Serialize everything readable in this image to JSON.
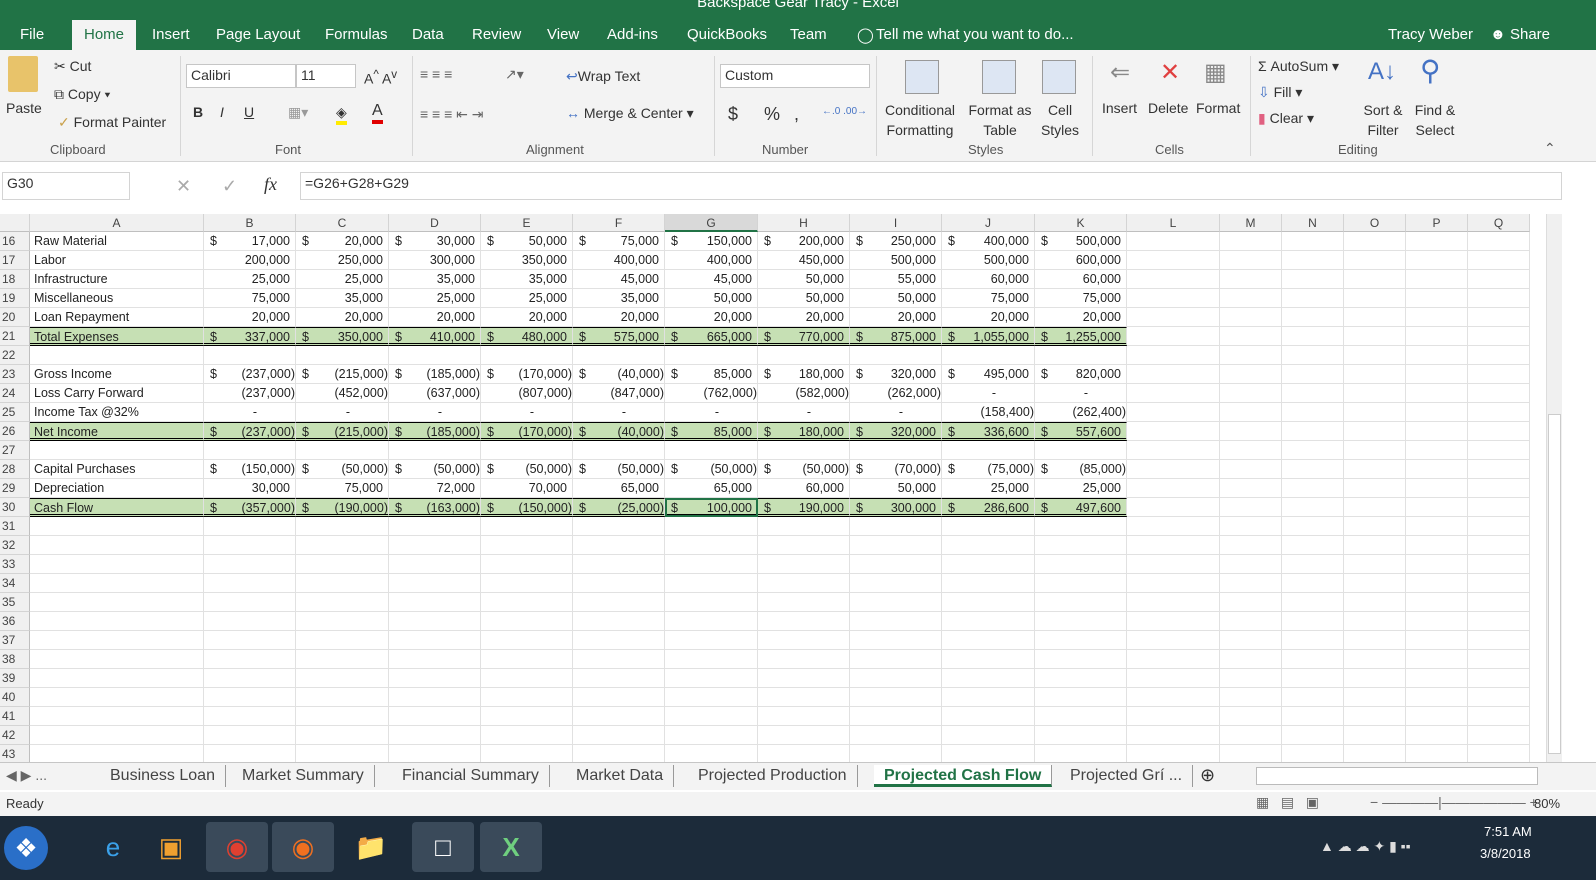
{
  "title": "Backspace Gear Tracy - Excel",
  "ribbon_tabs": [
    "File",
    "Home",
    "Insert",
    "Page Layout",
    "Formulas",
    "Data",
    "Review",
    "View",
    "Add-ins",
    "QuickBooks",
    "Team"
  ],
  "tell_me": "Tell me what you want to do...",
  "user": "Tracy Weber",
  "share": "Share",
  "clipboard": {
    "paste": "Paste",
    "cut": "Cut",
    "copy": "Copy",
    "format_painter": "Format Painter",
    "group": "Clipboard"
  },
  "font": {
    "name": "Calibri",
    "size": "11",
    "group": "Font",
    "bold": "B",
    "italic": "I",
    "underline": "U"
  },
  "alignment": {
    "wrap": "Wrap Text",
    "merge": "Merge & Center",
    "group": "Alignment"
  },
  "number": {
    "format": "Custom",
    "currency": "$",
    "percent": "%",
    "comma": ",",
    "group": "Number"
  },
  "styles": {
    "conditional": "Conditional Formatting",
    "format_table": "Format as Table",
    "cell_styles": "Cell Styles",
    "group": "Styles"
  },
  "cells": {
    "insert": "Insert",
    "delete": "Delete",
    "format": "Format",
    "group": "Cells"
  },
  "editing": {
    "autosum": "AutoSum",
    "fill": "Fill",
    "clear": "Clear",
    "sort": "Sort & Filter",
    "find": "Find & Select",
    "group": "Editing"
  },
  "name_box": "G30",
  "formula": "=G26+G28+G29",
  "columns": [
    "A",
    "B",
    "C",
    "D",
    "E",
    "F",
    "G",
    "H",
    "I",
    "J",
    "K",
    "L",
    "M",
    "N",
    "O",
    "P",
    "Q"
  ],
  "selected_column": "G",
  "rows": [
    {
      "n": "16",
      "label": "Raw Material",
      "dollar": true,
      "values": [
        "17,000",
        "20,000",
        "30,000",
        "50,000",
        "75,000",
        "150,000",
        "200,000",
        "250,000",
        "400,000",
        "500,000"
      ]
    },
    {
      "n": "17",
      "label": "Labor",
      "values": [
        "200,000",
        "250,000",
        "300,000",
        "350,000",
        "400,000",
        "400,000",
        "450,000",
        "500,000",
        "500,000",
        "600,000"
      ]
    },
    {
      "n": "18",
      "label": "Infrastructure",
      "values": [
        "25,000",
        "25,000",
        "35,000",
        "35,000",
        "45,000",
        "45,000",
        "50,000",
        "55,000",
        "60,000",
        "60,000"
      ]
    },
    {
      "n": "19",
      "label": "Miscellaneous",
      "values": [
        "75,000",
        "35,000",
        "25,000",
        "25,000",
        "35,000",
        "50,000",
        "50,000",
        "50,000",
        "75,000",
        "75,000"
      ]
    },
    {
      "n": "20",
      "label": "Loan Repayment",
      "values": [
        "20,000",
        "20,000",
        "20,000",
        "20,000",
        "20,000",
        "20,000",
        "20,000",
        "20,000",
        "20,000",
        "20,000"
      ]
    },
    {
      "n": "21",
      "label": "Total Expenses",
      "dollar": true,
      "total": true,
      "values": [
        "337,000",
        "350,000",
        "410,000",
        "480,000",
        "575,000",
        "665,000",
        "770,000",
        "875,000",
        "1,055,000",
        "1,255,000"
      ]
    },
    {
      "n": "22",
      "label": "",
      "values": []
    },
    {
      "n": "23",
      "label": "Gross Income",
      "dollar": true,
      "values": [
        "(237,000)",
        "(215,000)",
        "(185,000)",
        "(170,000)",
        "(40,000)",
        "85,000",
        "180,000",
        "320,000",
        "495,000",
        "820,000"
      ]
    },
    {
      "n": "24",
      "label": "Loss Carry Forward",
      "values": [
        "(237,000)",
        "(452,000)",
        "(637,000)",
        "(807,000)",
        "(847,000)",
        "(762,000)",
        "(582,000)",
        "(262,000)",
        "-",
        "-"
      ]
    },
    {
      "n": "25",
      "label": "Income Tax @32%",
      "values": [
        "-",
        "-",
        "-",
        "-",
        "-",
        "-",
        "-",
        "-",
        "(158,400)",
        "(262,400)"
      ]
    },
    {
      "n": "26",
      "label": "Net Income",
      "dollar": true,
      "total": true,
      "values": [
        "(237,000)",
        "(215,000)",
        "(185,000)",
        "(170,000)",
        "(40,000)",
        "85,000",
        "180,000",
        "320,000",
        "336,600",
        "557,600"
      ]
    },
    {
      "n": "27",
      "label": "",
      "values": []
    },
    {
      "n": "28",
      "label": "Capital Purchases",
      "dollar": true,
      "values": [
        "(150,000)",
        "(50,000)",
        "(50,000)",
        "(50,000)",
        "(50,000)",
        "(50,000)",
        "(50,000)",
        "(70,000)",
        "(75,000)",
        "(85,000)"
      ]
    },
    {
      "n": "29",
      "label": "Depreciation",
      "values": [
        "30,000",
        "75,000",
        "72,000",
        "70,000",
        "65,000",
        "65,000",
        "60,000",
        "50,000",
        "25,000",
        "25,000"
      ]
    },
    {
      "n": "30",
      "label": "Cash Flow",
      "dollar": true,
      "total": true,
      "values": [
        "(357,000)",
        "(190,000)",
        "(163,000)",
        "(150,000)",
        "(25,000)",
        "100,000",
        "190,000",
        "300,000",
        "286,600",
        "497,600"
      ]
    },
    {
      "n": "31",
      "label": "",
      "values": []
    },
    {
      "n": "32",
      "label": "",
      "values": []
    },
    {
      "n": "33",
      "label": "",
      "values": []
    },
    {
      "n": "34",
      "label": "",
      "values": []
    },
    {
      "n": "35",
      "label": "",
      "values": []
    },
    {
      "n": "36",
      "label": "",
      "values": []
    },
    {
      "n": "37",
      "label": "",
      "values": []
    },
    {
      "n": "38",
      "label": "",
      "values": []
    },
    {
      "n": "39",
      "label": "",
      "values": []
    },
    {
      "n": "40",
      "label": "",
      "values": []
    },
    {
      "n": "41",
      "label": "",
      "values": []
    },
    {
      "n": "42",
      "label": "",
      "values": []
    },
    {
      "n": "43",
      "label": "",
      "values": []
    }
  ],
  "currency_symbol": "$",
  "sheet_tabs": [
    "Business Loan",
    "Market Summary",
    "Financial Summary",
    "Market Data",
    "Projected Production",
    "Projected Cash Flow",
    "Projected Grí ..."
  ],
  "active_sheet": "Projected Cash Flow",
  "status": "Ready",
  "zoom": "80%",
  "clock": {
    "time": "7:51 AM",
    "date": "3/8/2018"
  }
}
